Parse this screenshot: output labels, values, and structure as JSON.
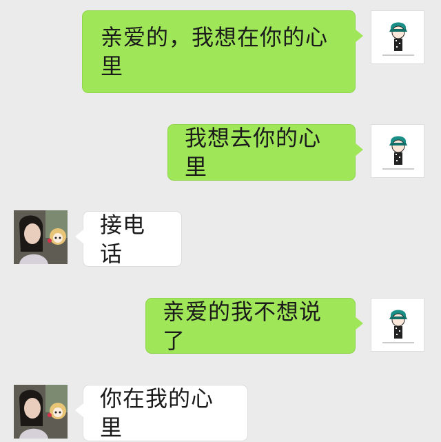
{
  "chat": {
    "messages": [
      {
        "direction": "outgoing",
        "text": "亲爱的，我想在你的心里"
      },
      {
        "direction": "outgoing",
        "text": "我想去你的心里"
      },
      {
        "direction": "incoming",
        "text": "接电话"
      },
      {
        "direction": "outgoing",
        "text": "亲爱的我不想说了"
      },
      {
        "direction": "incoming",
        "text": "你在我的心里"
      }
    ]
  },
  "colors": {
    "background": "#ebebeb",
    "outgoing_bubble": "#9fe659",
    "incoming_bubble": "#ffffff"
  },
  "icons": {
    "self_avatar": "cartoon-boy-avatar",
    "other_avatar": "girl-photo-avatar"
  }
}
